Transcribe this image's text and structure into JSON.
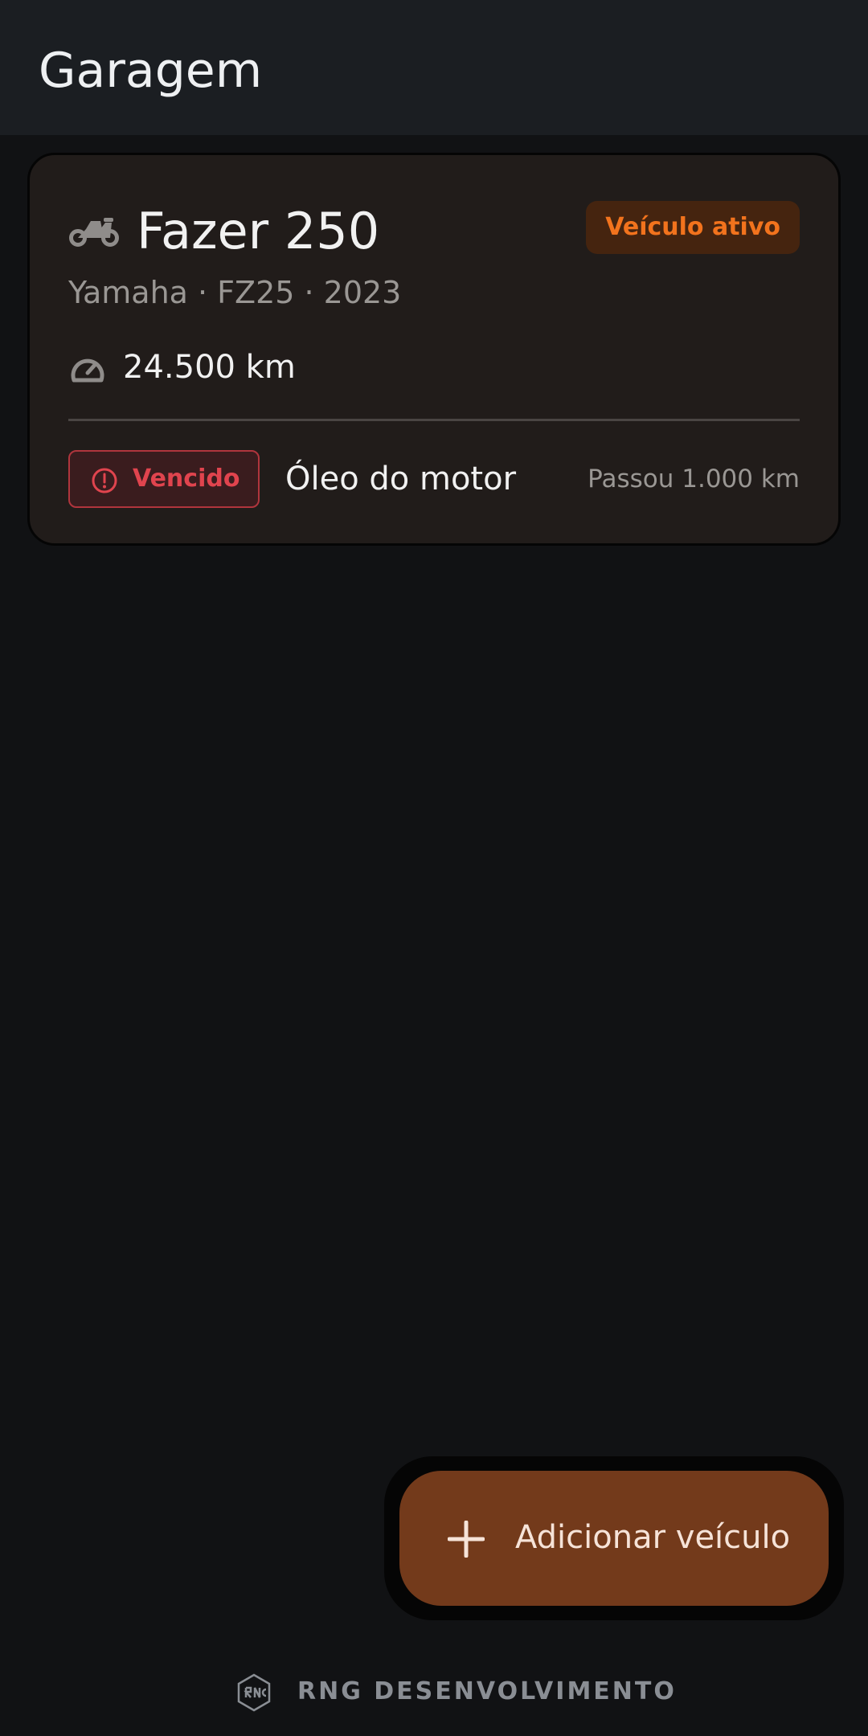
{
  "appbar": {
    "title": "Garagem"
  },
  "vehicle": {
    "icon": "motorcycle-icon",
    "name": "Fazer 250",
    "active_label": "Veículo ativo",
    "subtitle": "Yamaha · FZ25 · 2023",
    "odometer_icon": "speedometer-icon",
    "odometer": "24.500 km",
    "maintenance": {
      "status_icon": "alert-circle-icon",
      "status_label": "Vencido",
      "service": "Óleo do motor",
      "detail": "Passou 1.000 km"
    }
  },
  "fab": {
    "icon": "plus-icon",
    "label": "Adicionar veículo"
  },
  "footer": {
    "logo_icon": "rng-logo-icon",
    "text": "RNG DESENVOLVIMENTO"
  },
  "colors": {
    "background": "#111214",
    "appbar": "#1b1e22",
    "card": "#211c1a",
    "accent_orange": "#f2731d",
    "danger": "#e0444e",
    "fab": "#733a1b"
  }
}
